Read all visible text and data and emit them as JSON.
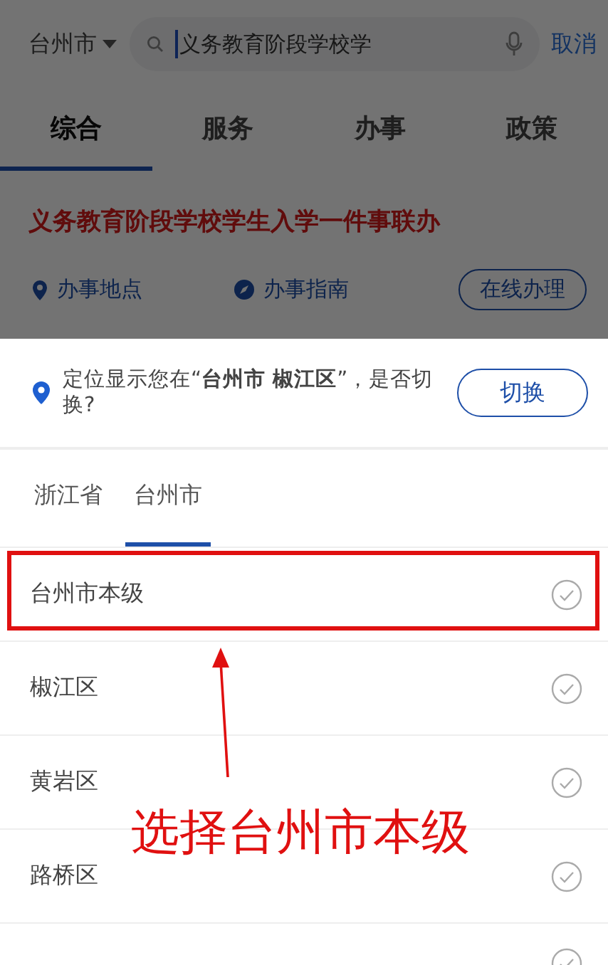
{
  "header": {
    "city": "台州市",
    "search": {
      "value": "义务教育阶段学校学"
    },
    "cancel": "取消"
  },
  "tabs": [
    {
      "label": "综合",
      "selected": true
    },
    {
      "label": "服务",
      "selected": false
    },
    {
      "label": "办事",
      "selected": false
    },
    {
      "label": "政策",
      "selected": false
    }
  ],
  "result": {
    "title": "义务教育阶段学校学生入学一件事联办",
    "links": [
      {
        "kind": "pin",
        "label": "办事地点"
      },
      {
        "kind": "compass",
        "label": "办事指南"
      }
    ],
    "action": "在线办理"
  },
  "location_prompt": {
    "text": "定位显示您在“**台州市 椒江区**”，是否切换?",
    "button": "切换"
  },
  "region_tabs": [
    {
      "label": "浙江省",
      "selected": false
    },
    {
      "label": "台州市",
      "selected": true
    }
  ],
  "regions": [
    {
      "name": "台州市本级",
      "highlighted": true
    },
    {
      "name": "椒江区",
      "highlighted": false
    },
    {
      "name": "黄岩区",
      "highlighted": false
    },
    {
      "name": "路桥区",
      "highlighted": false
    }
  ],
  "annotation": {
    "caption": "选择台州市本级"
  }
}
